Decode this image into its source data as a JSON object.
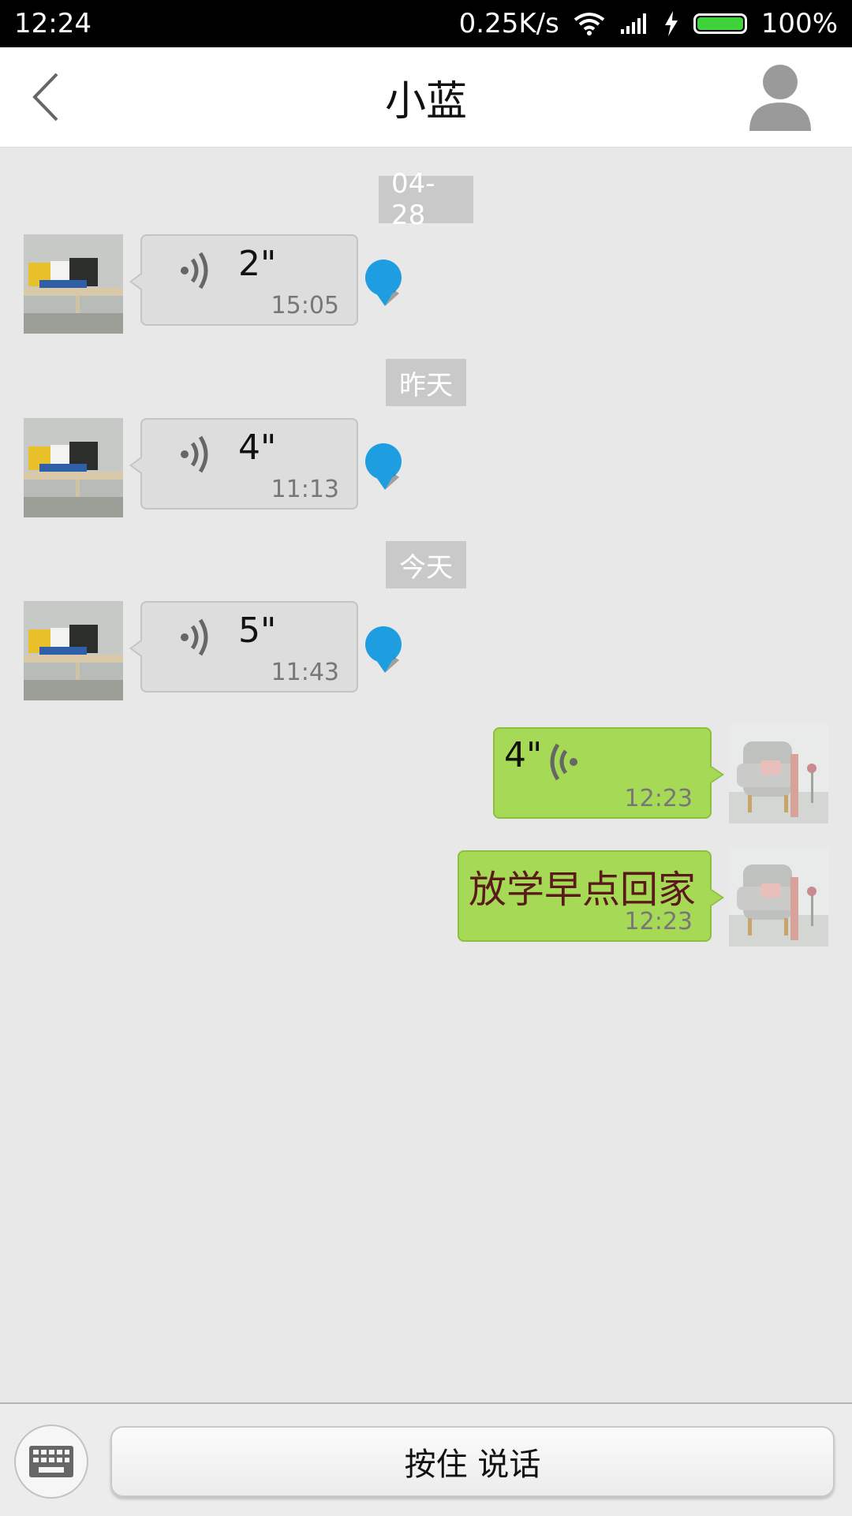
{
  "status_bar": {
    "time": "12:24",
    "network_speed": "0.25K/s",
    "battery_percent": "100%",
    "battery_level": 1.0,
    "icons": [
      "wifi-icon",
      "signal-icon",
      "charging-icon",
      "battery-icon"
    ]
  },
  "header": {
    "title": "小蓝",
    "back_icon": "chevron-left-icon",
    "profile_icon": "person-icon"
  },
  "messages": [
    {
      "type": "date",
      "label": "04-28"
    },
    {
      "type": "voice",
      "direction": "incoming",
      "duration": "2\"",
      "time": "15:05",
      "unread": true
    },
    {
      "type": "date",
      "label": "昨天"
    },
    {
      "type": "voice",
      "direction": "incoming",
      "duration": "4\"",
      "time": "11:13",
      "unread": true
    },
    {
      "type": "date",
      "label": "今天"
    },
    {
      "type": "voice",
      "direction": "incoming",
      "duration": "5\"",
      "time": "11:43",
      "unread": true
    },
    {
      "type": "voice",
      "direction": "outgoing",
      "duration": "4\"",
      "time": "12:23"
    },
    {
      "type": "text",
      "direction": "outgoing",
      "text": "放学早点回家",
      "time": "12:23"
    }
  ],
  "bottom_bar": {
    "keyboard_icon": "keyboard-icon",
    "hold_to_talk_label": "按住 说话"
  },
  "colors": {
    "outgoing_bubble": "#a6d955",
    "incoming_bubble": "#dddddd",
    "unread_dot": "#1e9ee0",
    "background": "#e8e8e8"
  }
}
